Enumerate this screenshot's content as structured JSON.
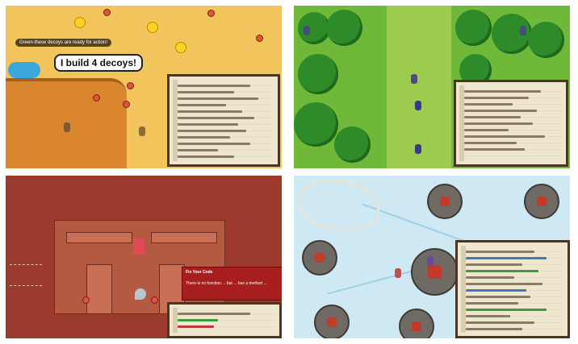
{
  "panels": {
    "desert": {
      "tag_text": "Green-these decoys are ready for action!",
      "speech_text": "I build 4 decoys!"
    },
    "dungeon": {
      "error_title": "Fix Your Code",
      "error_message": "There is no function ... but ... has a method ..."
    }
  },
  "icons": [
    "coin-icon",
    "hero-icon",
    "tree-icon",
    "skeleton-icon"
  ],
  "colors": {
    "desert": "#f2c45c",
    "forest": "#6fb83a",
    "dungeon": "#9b3b2e",
    "ice": "#cfe9f4",
    "editor_bg": "#efe6cf",
    "error_bg": "#a81d1d"
  }
}
